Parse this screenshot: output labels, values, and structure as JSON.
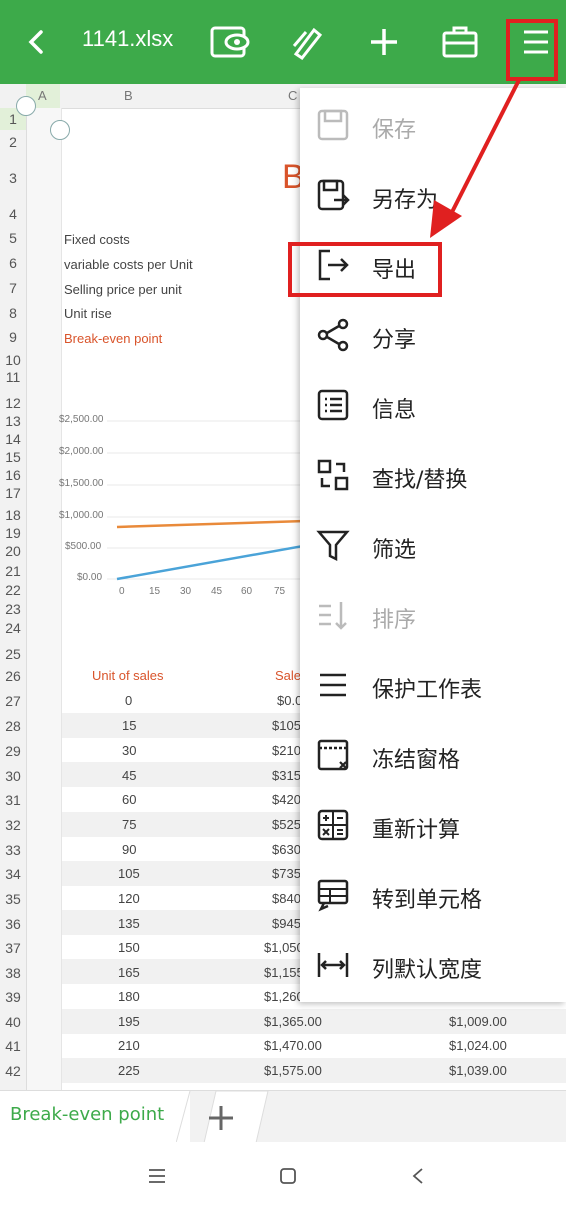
{
  "toolbar": {
    "back_icon": "chevron-left-icon",
    "file_name": "1141.xlsx",
    "read_mode_icon": "eye-book-icon",
    "pen_icon": "pen-icon",
    "add_icon": "plus-icon",
    "tools_icon": "toolbox-icon",
    "menu_icon": "hamburger-icon",
    "accent": "#3daa4a",
    "highlight_color": "#e02020"
  },
  "columns": [
    "A",
    "B",
    "C"
  ],
  "rows": [
    "1",
    "2",
    "3",
    "4",
    "5",
    "6",
    "7",
    "8",
    "9",
    "10",
    "11",
    "12",
    "13",
    "14",
    "15",
    "16",
    "17",
    "18",
    "19",
    "20",
    "21",
    "22",
    "23",
    "24",
    "25",
    "26",
    "27",
    "28",
    "29",
    "30",
    "31",
    "32",
    "33",
    "34",
    "35",
    "36",
    "37",
    "38",
    "39",
    "40",
    "41",
    "42"
  ],
  "sheet": {
    "title_fragment": "B",
    "labels": [
      "Fixed costs",
      "variable costs per Unit",
      "Selling price per unit",
      "Unit rise",
      "Break-even point"
    ],
    "chart_y_ticks": [
      "$2,500.00",
      "$2,000.00",
      "$1,500.00",
      "$1,000.00",
      "$500.00",
      "$0.00"
    ],
    "chart_x_ticks": [
      "0",
      "15",
      "30",
      "45",
      "60",
      "75"
    ],
    "table_header_units": "Unit of sales",
    "table_header_sales": "Sale",
    "units": [
      "0",
      "15",
      "30",
      "45",
      "60",
      "75",
      "90",
      "105",
      "120",
      "135",
      "150",
      "165",
      "180",
      "195",
      "210",
      "225"
    ],
    "sales": [
      "$0.0",
      "$105.",
      "$210.",
      "$315.",
      "$420.",
      "$525.",
      "$630.",
      "$735.",
      "$840.",
      "$945.",
      "$1,050",
      "$1,155",
      "$1,260",
      "$1,365.00",
      "$1,470.00",
      "$1,575.00"
    ],
    "costs_visible": [
      "$1,009.00",
      "$1,024.00",
      "$1,039.00"
    ]
  },
  "menu": {
    "items": [
      {
        "label": "保存",
        "icon": "save-icon",
        "disabled": true
      },
      {
        "label": "另存为",
        "icon": "save-as-icon",
        "disabled": false
      },
      {
        "label": "导出",
        "icon": "export-icon",
        "disabled": false
      },
      {
        "label": "分享",
        "icon": "share-icon",
        "disabled": false
      },
      {
        "label": "信息",
        "icon": "info-list-icon",
        "disabled": false
      },
      {
        "label": "查找/替换",
        "icon": "find-replace-icon",
        "disabled": false
      },
      {
        "label": "筛选",
        "icon": "filter-icon",
        "disabled": false
      },
      {
        "label": "排序",
        "icon": "sort-icon",
        "disabled": true
      },
      {
        "label": "保护工作表",
        "icon": "protect-icon",
        "disabled": false
      },
      {
        "label": "冻结窗格",
        "icon": "freeze-icon",
        "disabled": false
      },
      {
        "label": "重新计算",
        "icon": "calculator-icon",
        "disabled": false
      },
      {
        "label": "转到单元格",
        "icon": "goto-cell-icon",
        "disabled": false
      },
      {
        "label": "列默认宽度",
        "icon": "column-width-icon",
        "disabled": false
      }
    ]
  },
  "tabs": {
    "active": "Break-even point",
    "add_icon": "plus-icon"
  },
  "nav": {
    "menu_icon": "nav-menu-icon",
    "home_icon": "nav-home-icon",
    "back_icon": "nav-back-icon"
  }
}
